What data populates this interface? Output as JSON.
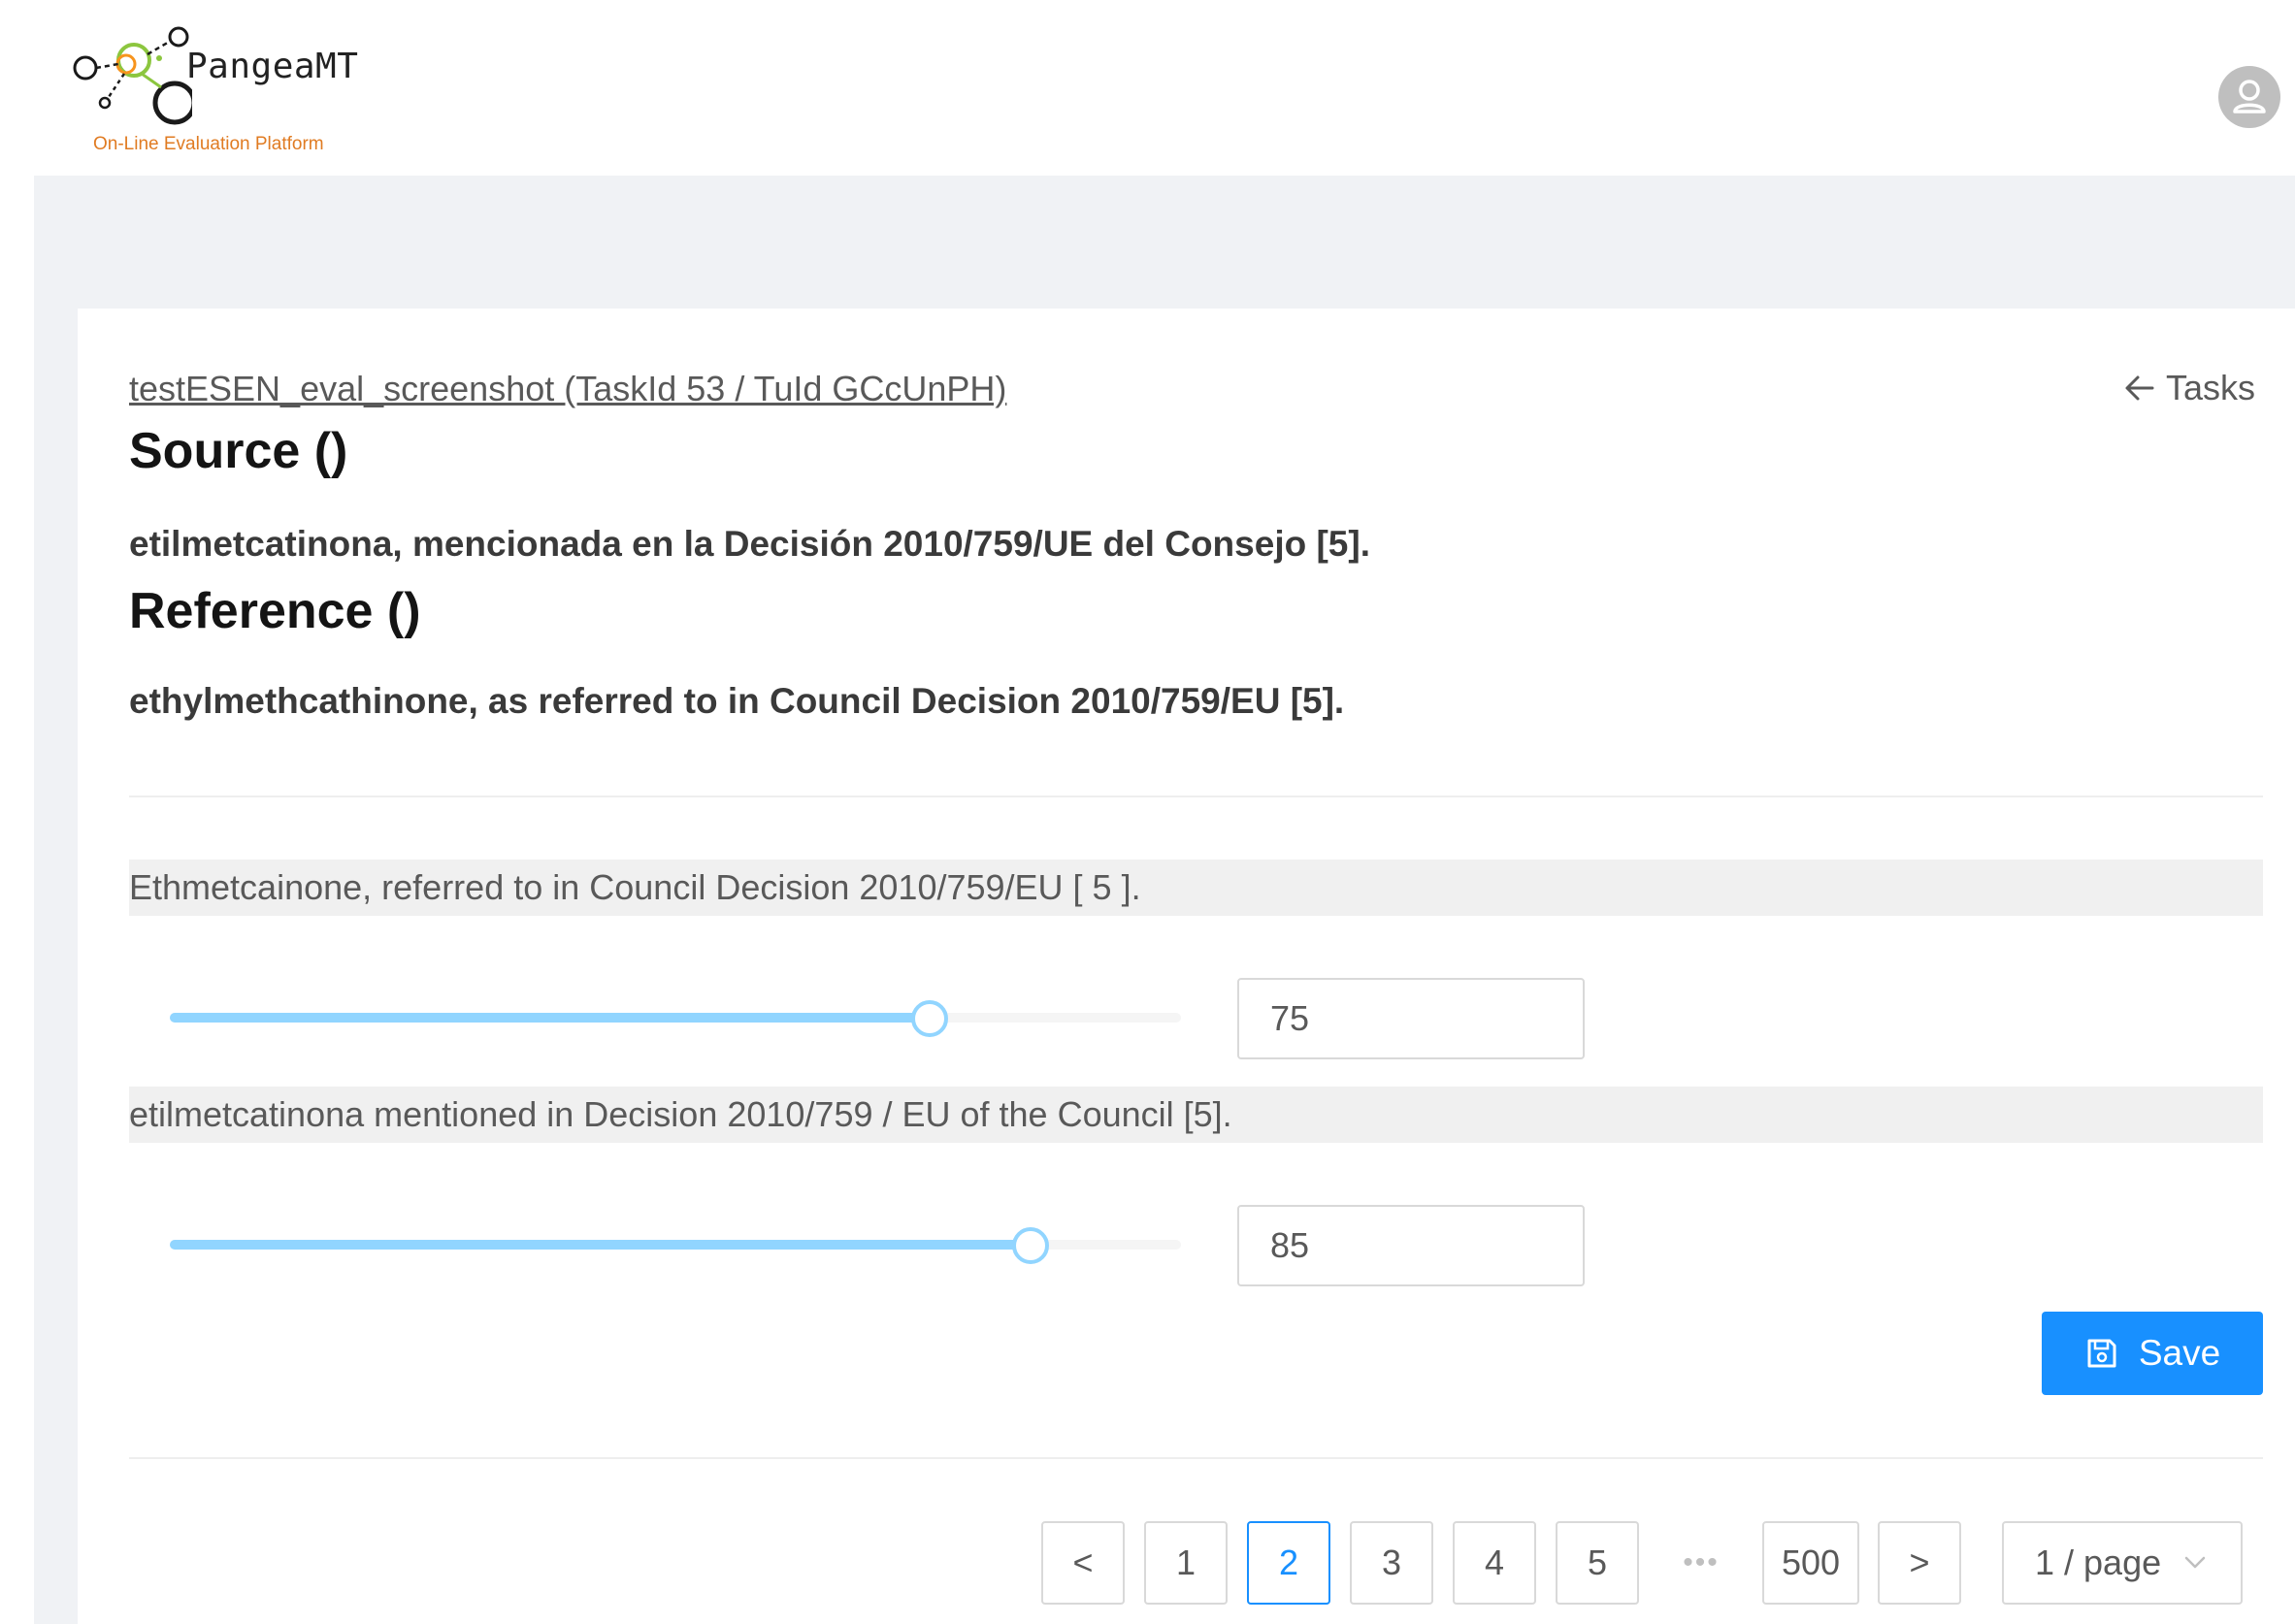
{
  "header": {
    "logo_name": "PangeaMT",
    "logo_tagline": "On-Line Evaluation Platform"
  },
  "task": {
    "title": "testESEN_eval_screenshot (TaskId 53 / TuId GCcUnPH)",
    "back_label": "Tasks"
  },
  "source": {
    "heading": "Source ()",
    "text": "etilmetcatinona, mencionada en la Decisión 2010/759/UE del Consejo [5]."
  },
  "reference": {
    "heading": "Reference ()",
    "text": "ethylmethcathinone, as referred to in Council Decision 2010/759/EU [5]."
  },
  "translations": [
    {
      "text": "Ethmetcainone, referred to in Council Decision 2010/759/EU [ 5 ].",
      "score": "75",
      "score_fraction": 0.75
    },
    {
      "text": "etilmetcatinona mentioned in Decision 2010/759 / EU of the Council [5].",
      "score": "85",
      "score_fraction": 0.85
    }
  ],
  "save_label": "Save",
  "pagination": {
    "prev": "<",
    "pages": [
      "1",
      "2",
      "3",
      "4",
      "5"
    ],
    "ellipsis": "•••",
    "last_page": "500",
    "next": ">",
    "current": "2",
    "page_size": "1 / page"
  },
  "colors": {
    "primary": "#1890ff",
    "slider_track": "#91d5ff",
    "logo_tagline": "#e07b22",
    "logo_green": "#8cc63f",
    "logo_orange": "#f7941d"
  },
  "icons": {
    "back": "arrow-left-icon",
    "save": "save-icon",
    "avatar": "user-icon",
    "page_size": "chevron-down-icon"
  }
}
